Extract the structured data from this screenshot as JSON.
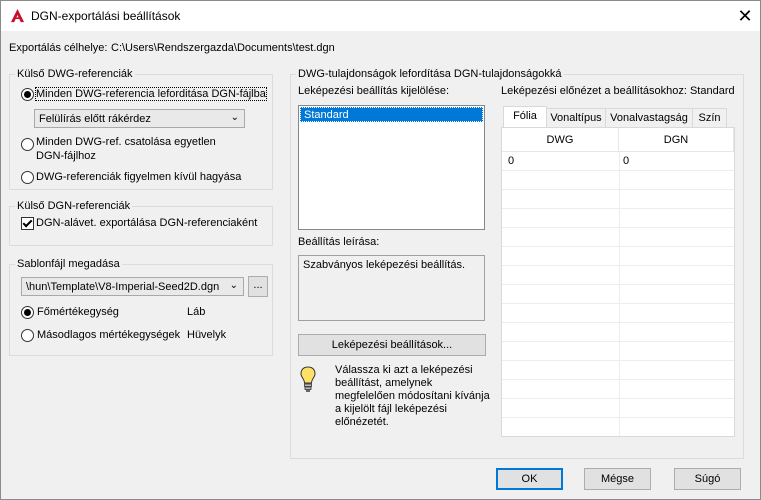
{
  "window": {
    "title": "DGN-exportálási beállítások",
    "close_glyph": "✕"
  },
  "export_target": {
    "label": "Exportálás célhelye:",
    "path": "C:\\Users\\Rendszergazda\\Documents\\test.dgn"
  },
  "external_dwg": {
    "title": "Külső DWG-referenciák",
    "options": [
      "Minden DWG-referencia leforditása DGN-fájlba",
      "Minden DWG-ref. csatolása egyetlen\nDGN-fájlhoz",
      "DWG-referenciák figyelmen kívül hagyása"
    ],
    "selected_index": 0,
    "overwrite_combo": "Felülírás előtt rákérdez"
  },
  "external_dgn": {
    "title": "Külső DGN-referenciák",
    "checkbox_label": "DGN-alávet. exportálása DGN-referenciaként",
    "checked": true
  },
  "seed": {
    "title": "Sablonfájl megadása",
    "path": "\\hun\\Template\\V8-Imperial-Seed2D.dgn",
    "browse_label": "...",
    "units": [
      {
        "label": "Főmértékegység",
        "value": "Láb",
        "selected": true
      },
      {
        "label": "Másodlagos mértékegységek",
        "value": "Hüvelyk",
        "selected": false
      }
    ]
  },
  "mapping": {
    "title": "DWG-tulajdonságok lefordítása DGN-tulajdonságokká",
    "select_label": "Leképezési beállítás kijelölése:",
    "list_items": [
      "Standard"
    ],
    "preview_label": "Leképezési előnézet a beállításokhoz: Standard",
    "description_label": "Beállítás leírása:",
    "description_text": "Szabványos leképezési beállítás.",
    "setup_button": "Leképezési beállítások...",
    "tip": "Válassza ki azt a leképezési\nbeállítást, amelynek\nmegfelelően módosítani kívánja\na kijelölt fájl leképezési\nelőnézetét.",
    "tabs": [
      "Fólia",
      "Vonaltípus",
      "Vonalvastagság",
      "Szín"
    ],
    "active_tab": 0,
    "columns": [
      "DWG",
      "DGN"
    ],
    "rows": [
      [
        "0",
        "0"
      ]
    ]
  },
  "buttons": {
    "ok": "OK",
    "cancel": "Mégse",
    "help": "Súgó"
  },
  "colors": {
    "accent": "#0078d7",
    "app_icon": "#c8102e"
  }
}
